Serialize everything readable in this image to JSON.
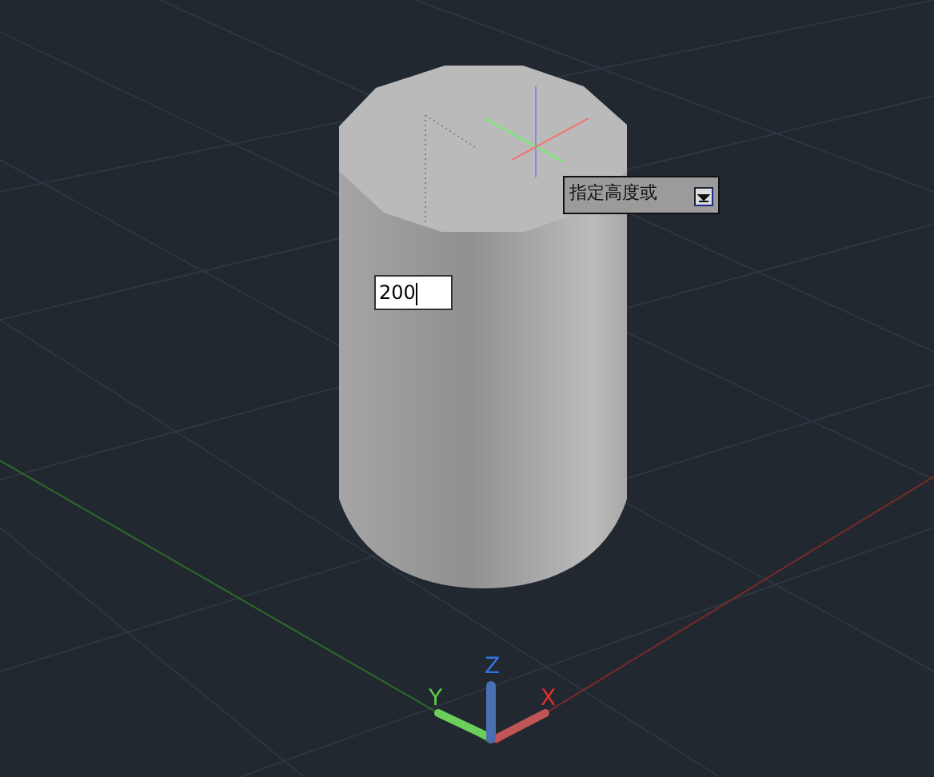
{
  "prompt": {
    "text": "指定高度或"
  },
  "input": {
    "value": "200"
  },
  "ucs": {
    "x_label": "X",
    "y_label": "Y",
    "z_label": "Z"
  }
}
